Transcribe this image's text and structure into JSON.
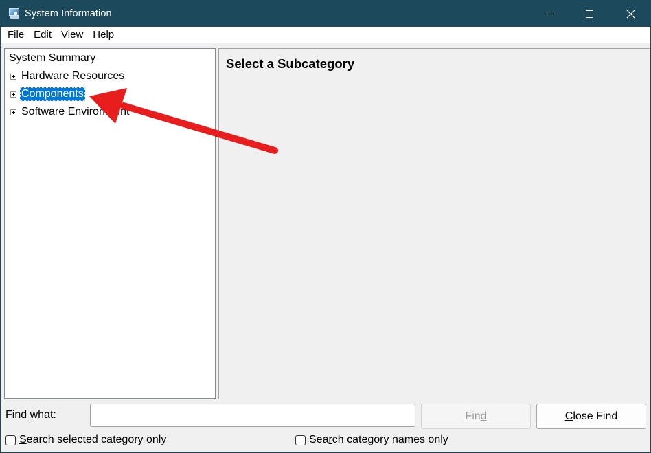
{
  "window": {
    "title": "System Information",
    "controls": {
      "minimize": "minimize-icon",
      "maximize": "maximize-icon",
      "close": "close-icon"
    },
    "titlebar_color": "#1c4a5c"
  },
  "menu": {
    "items": [
      {
        "label": "File"
      },
      {
        "label": "Edit"
      },
      {
        "label": "View"
      },
      {
        "label": "Help"
      }
    ]
  },
  "tree": {
    "root": "System Summary",
    "nodes": [
      {
        "label": "Hardware Resources",
        "selected": false
      },
      {
        "label": "Components",
        "selected": true
      },
      {
        "label": "Software Environment",
        "selected": false
      }
    ],
    "selection_color": "#0078d7"
  },
  "detail": {
    "heading": "Select a Subcategory"
  },
  "find": {
    "label_pre": "Find ",
    "label_accel": "w",
    "label_post": "hat:",
    "value": "",
    "find_button": {
      "pre": "Fin",
      "accel": "d",
      "post": ""
    },
    "close_button": {
      "pre": "",
      "accel": "C",
      "post": "lose Find"
    }
  },
  "options": {
    "selected_only": {
      "pre": "",
      "accel": "S",
      "post": "earch selected category only",
      "checked": false
    },
    "names_only": {
      "pre": "Sea",
      "accel": "r",
      "post": "ch category names only",
      "checked": false
    }
  },
  "annotation": {
    "arrow_color": "#e81d1d",
    "points_to": "Components"
  }
}
